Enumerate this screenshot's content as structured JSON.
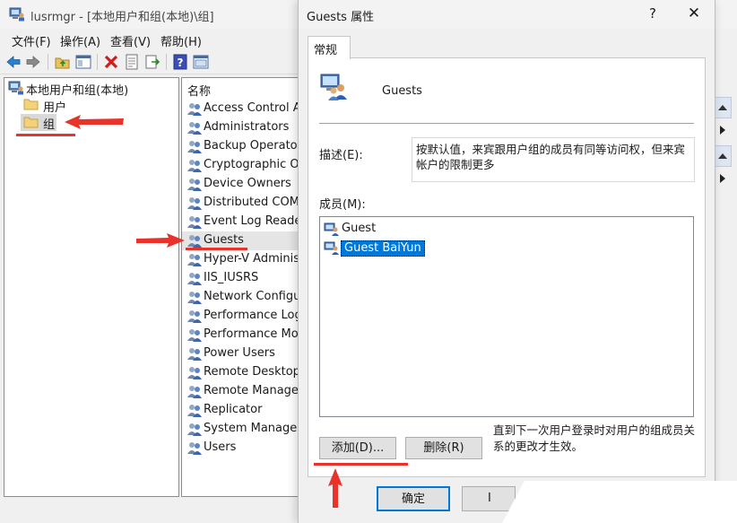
{
  "main_window": {
    "title": "lusrmgr - [本地用户和组(本地)\\组]",
    "menu": [
      "文件(F)",
      "操作(A)",
      "查看(V)",
      "帮助(H)"
    ],
    "tree": {
      "root": "本地用户和组(本地)",
      "children": [
        "用户",
        "组"
      ],
      "selected": "组"
    },
    "list": {
      "column_header": "名称",
      "items": [
        "Access Control Assistance Operators",
        "Administrators",
        "Backup Operators",
        "Cryptographic Operators",
        "Device Owners",
        "Distributed COM Users",
        "Event Log Readers",
        "Guests",
        "Hyper-V Administrators",
        "IIS_IUSRS",
        "Network Configuration Operators",
        "Performance Log Users",
        "Performance Monitor Users",
        "Power Users",
        "Remote Desktop Users",
        "Remote Management Users",
        "Replicator",
        "System Managed Accounts Group",
        "Users"
      ],
      "selected": "Guests"
    }
  },
  "dialog": {
    "title": "Guests 属性",
    "help_button": "?",
    "close_button": "✕",
    "tab": "常规",
    "group_name": "Guests",
    "description_label": "描述(E):",
    "description": "按默认值，来宾跟用户组的成员有同等访问权，但来宾帐户的限制更多",
    "members_label": "成员(M):",
    "members": [
      "Guest",
      "Guest BaiYun"
    ],
    "selected_member": "Guest BaiYun",
    "add_button": "添加(D)...",
    "remove_button": "删除(R)",
    "note": "直到下一次用户登录时对用户的组成员关系的更改才生效。",
    "ok_button": "确定",
    "cancel_button_partial": "I"
  },
  "colors": {
    "annotation_red": "#e8322a",
    "selection_blue": "#0078d7",
    "window_bg": "#f0f0f0"
  },
  "icons": [
    "computer-users-icon",
    "back-arrow-icon",
    "forward-arrow-icon",
    "up-folder-icon",
    "show-tree-icon",
    "delete-icon",
    "properties-icon",
    "export-icon",
    "help-icon",
    "view-icon",
    "folder-icon",
    "group-icon",
    "user-icon",
    "group-properties-icon"
  ]
}
